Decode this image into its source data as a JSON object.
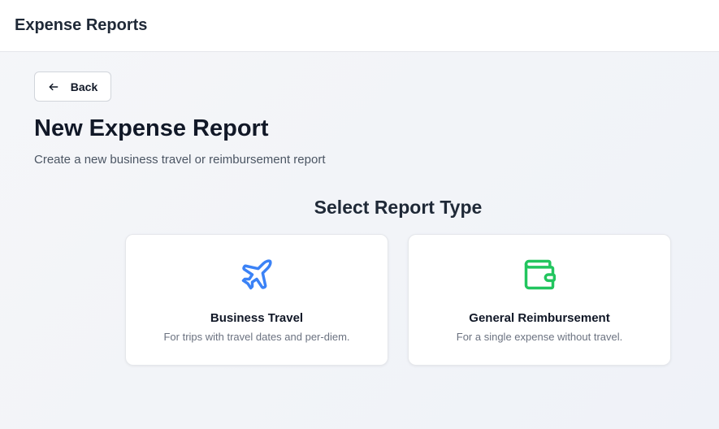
{
  "app": {
    "title": "Expense Reports"
  },
  "nav": {
    "back_label": "Back",
    "back_icon": "arrow-left-icon"
  },
  "page": {
    "title": "New Expense Report",
    "subtitle": "Create a new business travel or reimbursement report"
  },
  "selector": {
    "title": "Select Report Type",
    "options": [
      {
        "title": "Business Travel",
        "description": "For trips with travel dates and per-diem.",
        "icon": "airplane-icon",
        "icon_color": "#3b82f6"
      },
      {
        "title": "General Reimbursement",
        "description": "For a single expense without travel.",
        "icon": "wallet-icon",
        "icon_color": "#22c55e"
      }
    ]
  }
}
